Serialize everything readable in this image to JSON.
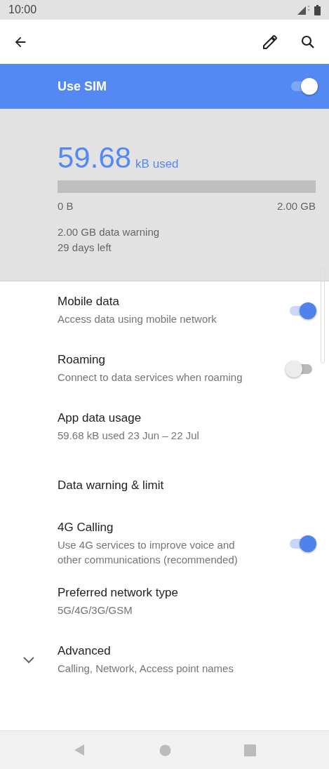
{
  "status_bar": {
    "time": "10:00"
  },
  "sim": {
    "label": "Use SIM",
    "on": true
  },
  "usage": {
    "amount": "59.68",
    "unit": "kB used",
    "level": 0,
    "min_label": "0 B",
    "max_label": "2.00 GB",
    "warning": "2.00 GB data warning",
    "days_left": "29 days left"
  },
  "settings": [
    {
      "kind": "switch",
      "title": "Mobile data",
      "subtitle": "Access data using mobile network",
      "on": true
    },
    {
      "kind": "switch",
      "title": "Roaming",
      "subtitle": "Connect to data services when roaming",
      "on": false
    },
    {
      "kind": "plain",
      "title": "App data usage",
      "subtitle": "59.68 kB used 23 Jun – 22 Jul"
    },
    {
      "kind": "plain",
      "title": "Data warning & limit"
    },
    {
      "kind": "switch",
      "title": "4G Calling",
      "subtitle": "Use 4G services to improve voice and other communications (recommended)",
      "on": true
    },
    {
      "kind": "plain",
      "title": "Preferred network type",
      "subtitle": "5G/4G/3G/GSM"
    },
    {
      "kind": "expand",
      "title": "Advanced",
      "subtitle": "Calling, Network, Access point names",
      "expanded": false
    }
  ]
}
